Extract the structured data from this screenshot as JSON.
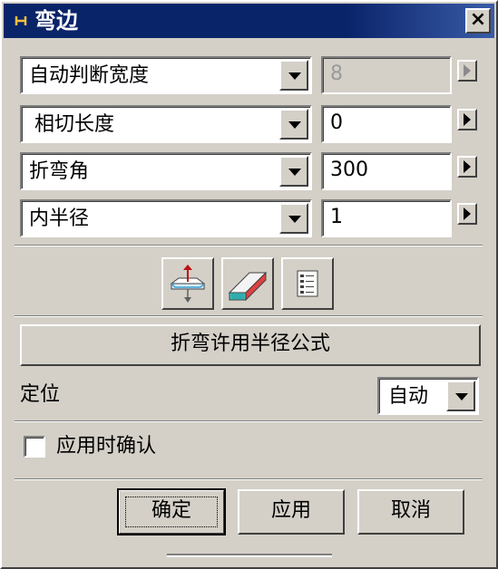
{
  "window": {
    "title": "弯边",
    "close_label": "×"
  },
  "rows": [
    {
      "select_value": "自动判断宽度",
      "input_value": "8",
      "input_disabled": true
    },
    {
      "select_value": "相切长度",
      "input_value": "0",
      "input_disabled": false
    },
    {
      "select_value": "折弯角",
      "input_value": "300",
      "input_disabled": false
    },
    {
      "select_value": "内半径",
      "input_value": "1",
      "input_disabled": false
    }
  ],
  "icon_buttons": [
    {
      "icon": "flip-direction-icon"
    },
    {
      "icon": "flange-solid-icon"
    },
    {
      "icon": "list-icon"
    }
  ],
  "bend_allowance_button": "折弯许用半径公式",
  "position": {
    "label": "定位",
    "select_value": "自动"
  },
  "confirm_on_apply": {
    "label": "应用时确认",
    "checked": false
  },
  "actions": {
    "ok": "确定",
    "apply": "应用",
    "cancel": "取消"
  },
  "colors": {
    "titlebar": "#0a246a",
    "face": "#d4d0c8"
  }
}
